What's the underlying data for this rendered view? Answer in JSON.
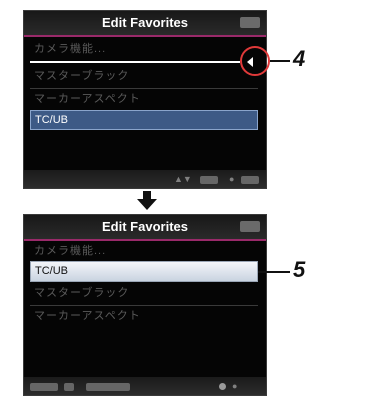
{
  "screen1": {
    "title": "Edit Favorites",
    "items": [
      "カメラ機能...",
      "マスターブラック",
      "マーカーアスペクト",
      "TC/UB"
    ],
    "selected_item": "TC/UB",
    "bottom_bar": {
      "left": "▲▼",
      "right": "●"
    }
  },
  "screen2": {
    "title": "Edit Favorites",
    "items": [
      "カメラ機能...",
      "TC/UB",
      "マスターブラック",
      "マーカーアスペクト"
    ],
    "selected_item": "TC/UB",
    "bottom_bar": {
      "right": "●"
    }
  },
  "callouts": {
    "step_4": "4",
    "step_5": "5"
  },
  "colors": {
    "selection_blue": "#3d5a86",
    "title_underline": "#9a2a6a",
    "callout_circle": "#e03a3a"
  },
  "icons": {
    "transition": "down-arrow-icon",
    "cursor": "left-triangle-cursor-icon"
  }
}
